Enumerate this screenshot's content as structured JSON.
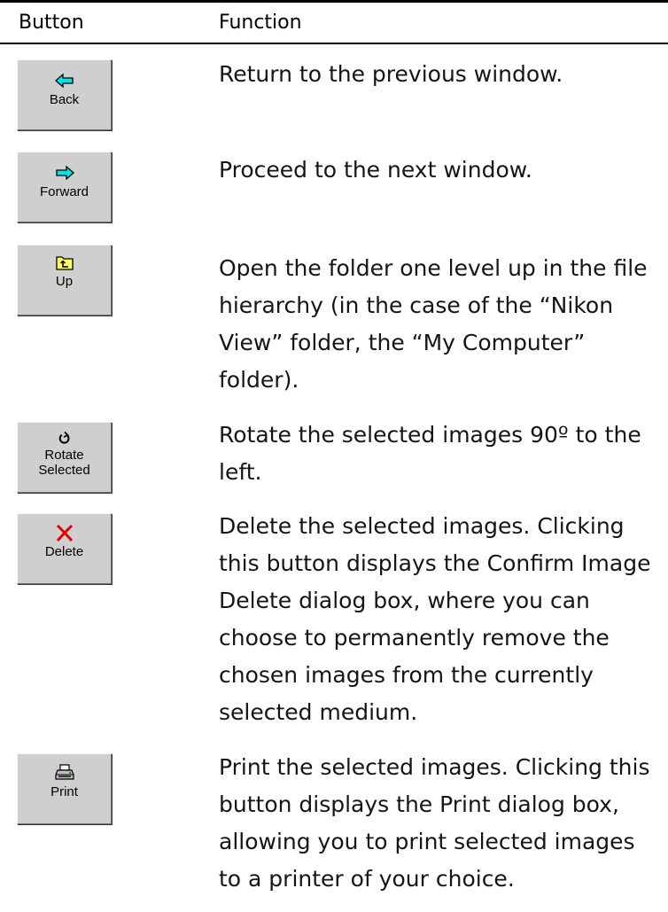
{
  "header": {
    "button_col": "Button",
    "function_col": "Function"
  },
  "rows": [
    {
      "button_label": "Back",
      "icon": "arrow-left-icon",
      "description": "Return to the previous window."
    },
    {
      "button_label": "Forward",
      "icon": "arrow-right-icon",
      "description": "Proceed to the next window."
    },
    {
      "button_label": "Up",
      "icon": "folder-up-icon",
      "description": "Open the folder one level up in the file hierarchy (in the case of the “Nikon View” folder, the “My Computer” folder)."
    },
    {
      "button_label_line1": "Rotate",
      "button_label_line2": "Selected",
      "icon": "rotate-left-icon",
      "description": "Rotate the selected images 90º to the left."
    },
    {
      "button_label": "Delete",
      "icon": "delete-x-icon",
      "description": "Delete the selected images.  Clicking this button displays the Confirm Image Delete dialog box, where you can choose to permanently remove the chosen images from the currently selected medium."
    },
    {
      "button_label": "Print",
      "icon": "printer-icon",
      "description": "Print the selected images.  Clicking this button displays the Print dialog box, allowing you to print selected images to a printer of your choice."
    }
  ],
  "colors": {
    "arrow_cyan": "#00e5e5",
    "folder_yellow": "#ffff66",
    "delete_red": "#e00000",
    "button_face": "#cfcfcf"
  }
}
